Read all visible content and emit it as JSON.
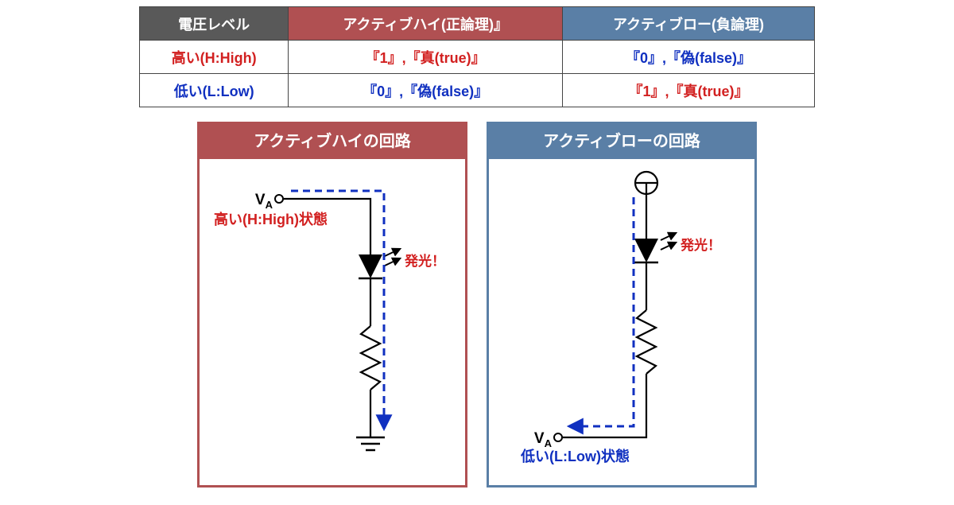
{
  "table": {
    "headers": {
      "level": "電圧レベル",
      "activeHigh": "アクティブハイ(正論理)』",
      "activeLow": "アクティブロー(負論理)"
    },
    "rows": [
      {
        "level": "高い(H:High)",
        "levelColor": "red",
        "ah": "『1』,『真(true)』",
        "ahColor": "red",
        "al": "『0』,『偽(false)』",
        "alColor": "blue"
      },
      {
        "level": "低い(L:Low)",
        "levelColor": "blue",
        "ah": "『0』,『偽(false)』",
        "ahColor": "blue",
        "al": "『1』,『真(true)』",
        "alColor": "red"
      }
    ]
  },
  "panels": {
    "high": {
      "title": "アクティブハイの回路",
      "va": "V",
      "vaSub": "A",
      "state": "高い(H:High)状態",
      "emit": "発光！"
    },
    "low": {
      "title": "アクティブローの回路",
      "va": "V",
      "vaSub": "A",
      "state": "低い(L:Low)状態",
      "emit": "発光！"
    }
  },
  "chart_data": {
    "type": "table",
    "description": "Logic level truth table and two LED circuit diagrams (active-high vs active-low).",
    "truth_table": [
      {
        "voltage_level": "High",
        "active_high_logic": {
          "value": 1,
          "bool": true
        },
        "active_low_logic": {
          "value": 0,
          "bool": false
        }
      },
      {
        "voltage_level": "Low",
        "active_high_logic": {
          "value": 0,
          "bool": false
        },
        "active_low_logic": {
          "value": 1,
          "bool": true
        }
      }
    ],
    "circuits": [
      {
        "name": "active_high",
        "VA": "High",
        "path": "VA → LED → resistor → GND",
        "led_emits": true
      },
      {
        "name": "active_low",
        "VA": "Low",
        "path": "VCC → LED → resistor → VA",
        "led_emits": true
      }
    ]
  }
}
